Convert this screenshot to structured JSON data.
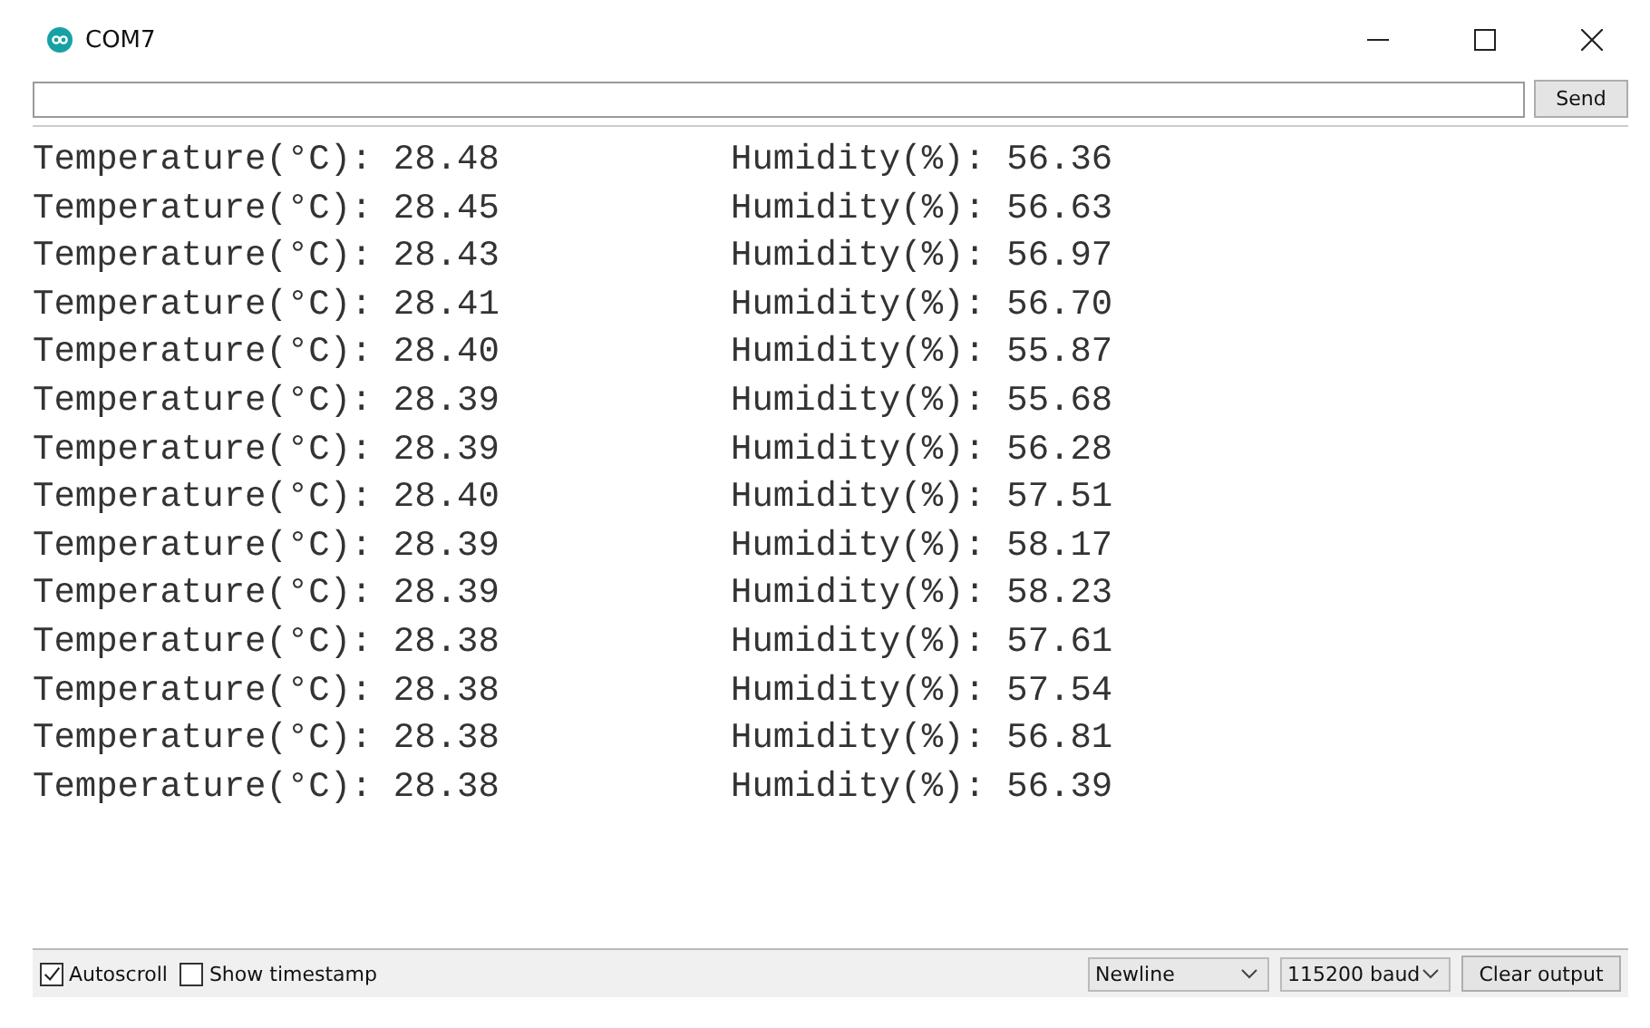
{
  "window": {
    "title": "COM7"
  },
  "send_button": "Send",
  "output": [
    {
      "temperature": "Temperature(°C): 28.48",
      "humidity": "Humidity(%): 56.36"
    },
    {
      "temperature": "Temperature(°C): 28.45",
      "humidity": "Humidity(%): 56.63"
    },
    {
      "temperature": "Temperature(°C): 28.43",
      "humidity": "Humidity(%): 56.97"
    },
    {
      "temperature": "Temperature(°C): 28.41",
      "humidity": "Humidity(%): 56.70"
    },
    {
      "temperature": "Temperature(°C): 28.40",
      "humidity": "Humidity(%): 55.87"
    },
    {
      "temperature": "Temperature(°C): 28.39",
      "humidity": "Humidity(%): 55.68"
    },
    {
      "temperature": "Temperature(°C): 28.39",
      "humidity": "Humidity(%): 56.28"
    },
    {
      "temperature": "Temperature(°C): 28.40",
      "humidity": "Humidity(%): 57.51"
    },
    {
      "temperature": "Temperature(°C): 28.39",
      "humidity": "Humidity(%): 58.17"
    },
    {
      "temperature": "Temperature(°C): 28.39",
      "humidity": "Humidity(%): 58.23"
    },
    {
      "temperature": "Temperature(°C): 28.38",
      "humidity": "Humidity(%): 57.61"
    },
    {
      "temperature": "Temperature(°C): 28.38",
      "humidity": "Humidity(%): 57.54"
    },
    {
      "temperature": "Temperature(°C): 28.38",
      "humidity": "Humidity(%): 56.81"
    },
    {
      "temperature": "Temperature(°C): 28.38",
      "humidity": "Humidity(%): 56.39"
    }
  ],
  "options": [
    {
      "label": "Autoscroll",
      "checked": true
    },
    {
      "label": "Show timestamp",
      "checked": false
    }
  ],
  "line_ending": "Newline",
  "baud_rate": "115200 baud",
  "clear_button": "Clear output"
}
